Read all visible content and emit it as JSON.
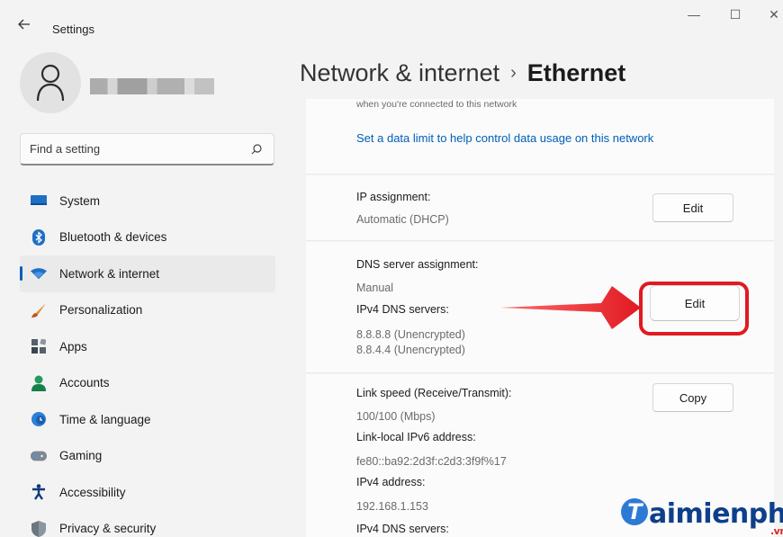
{
  "window": {
    "title": "Settings",
    "minimize_glyph": "—",
    "maximize_glyph": "☐",
    "close_glyph": "✕"
  },
  "sidebar": {
    "search_placeholder": "Find a setting",
    "items": [
      {
        "label": "System",
        "icon": "monitor-icon",
        "active": false
      },
      {
        "label": "Bluetooth & devices",
        "icon": "bluetooth-icon",
        "active": false
      },
      {
        "label": "Network & internet",
        "icon": "wifi-icon",
        "active": true
      },
      {
        "label": "Personalization",
        "icon": "brush-icon",
        "active": false
      },
      {
        "label": "Apps",
        "icon": "apps-icon",
        "active": false
      },
      {
        "label": "Accounts",
        "icon": "person-icon",
        "active": false
      },
      {
        "label": "Time & language",
        "icon": "globe-clock-icon",
        "active": false
      },
      {
        "label": "Gaming",
        "icon": "gamepad-icon",
        "active": false
      },
      {
        "label": "Accessibility",
        "icon": "accessibility-icon",
        "active": false
      },
      {
        "label": "Privacy & security",
        "icon": "shield-icon",
        "active": false
      }
    ]
  },
  "header": {
    "parent": "Network & internet",
    "separator": "›",
    "current": "Ethernet"
  },
  "main": {
    "data_limit": {
      "clipped_text": "when you're connected to this network",
      "link": "Set a data limit to help control data usage on this network"
    },
    "ip_assignment": {
      "label": "IP assignment:",
      "value": "Automatic (DHCP)",
      "button": "Edit"
    },
    "dns": {
      "label": "DNS server assignment:",
      "value": "Manual",
      "servers_label": "IPv4 DNS servers:",
      "server1": "8.8.8.8 (Unencrypted)",
      "server2": "8.8.4.4 (Unencrypted)",
      "button": "Edit"
    },
    "properties": {
      "link_speed_label": "Link speed (Receive/Transmit):",
      "link_speed_value": "100/100 (Mbps)",
      "ipv6_label": "Link-local IPv6 address:",
      "ipv6_value": "fe80::ba92:2d3f:c2d3:3f9f%17",
      "ipv4_label": "IPv4 address:",
      "ipv4_value": "192.168.1.153",
      "ipv4_dns_label": "IPv4 DNS servers:",
      "button": "Copy"
    }
  },
  "watermark": {
    "logo_letter": "T",
    "text": "aimienphi",
    "suffix": ".vn"
  },
  "colors": {
    "accent": "#005fb8",
    "highlight": "#e01a22"
  }
}
